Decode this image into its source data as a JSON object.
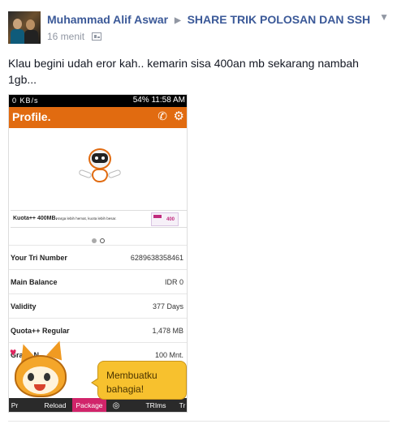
{
  "post": {
    "author": "Muhammad Alif Aswar",
    "group": "SHARE TRIK POLOSAN DAN SSH",
    "time": "16 menit",
    "text": "Klau begini udah eror kah.. kemarin sisa 400an mb sekarang nambah 1gb..."
  },
  "phone": {
    "status_left": "0 KB/s",
    "status_right": "54% 11:58 AM",
    "app_title": "Profile.",
    "banner_big": "Kuota++ 400MB.",
    "banner_small": "Harga lebih hemat, kuota lebih besar.",
    "banner_promo_num": "400",
    "rows": [
      {
        "label": "Your Tri Number",
        "value": "6289638358461"
      },
      {
        "label": "Main Balance",
        "value": "IDR 0"
      },
      {
        "label": "Validity",
        "value": "377 Days"
      },
      {
        "label": "Quota++ Regular",
        "value": "1,478 MB"
      },
      {
        "label": "Gratis N",
        "value": "100 Mnt."
      }
    ],
    "nav": {
      "pr": "Pr",
      "reload": "Reload",
      "package": "Package",
      "trims": "TRIms",
      "tr": "Tr"
    }
  },
  "sticker": {
    "line1": "Membuatku",
    "line2": "bahagia!"
  },
  "colors": {
    "brand_blue": "#3b5998",
    "tri_orange": "#e16b10",
    "package_pink": "#d1246a"
  },
  "icons": [
    "chevron-down-icon",
    "privacy-group-icon",
    "phone-call-icon",
    "settings-gear-icon",
    "arrow-right-icon"
  ]
}
